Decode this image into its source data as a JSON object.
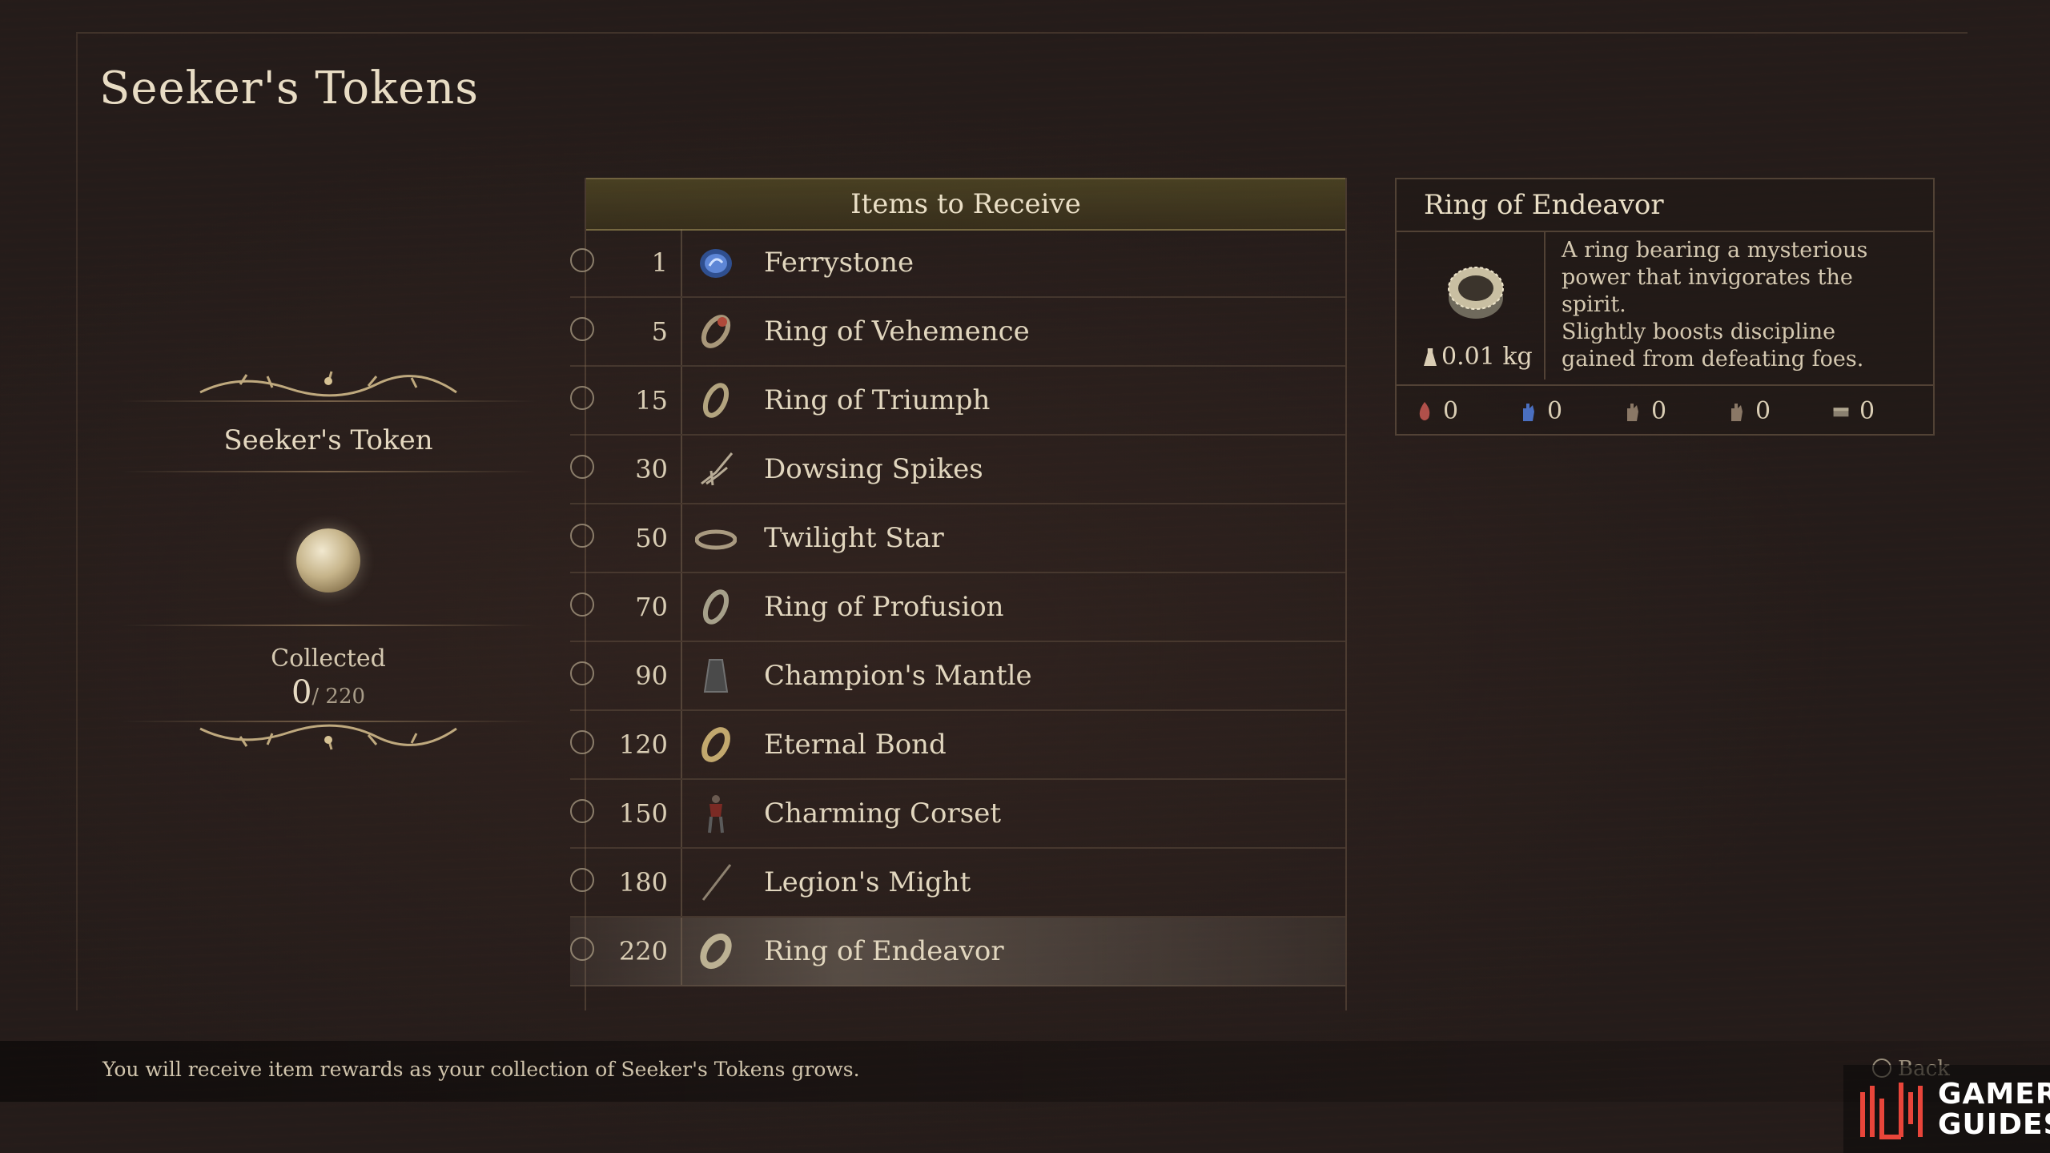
{
  "page": {
    "title": "Seeker's Tokens"
  },
  "token": {
    "name": "Seeker's Token",
    "collected_label": "Collected",
    "collected": "0",
    "total": "/ 220"
  },
  "list": {
    "header": "Items to Receive",
    "items": [
      {
        "count": "1",
        "name": "Ferrystone",
        "icon": "ferrystone-icon"
      },
      {
        "count": "5",
        "name": "Ring of Vehemence",
        "icon": "ring-icon"
      },
      {
        "count": "15",
        "name": "Ring of Triumph",
        "icon": "ring-icon"
      },
      {
        "count": "30",
        "name": "Dowsing Spikes",
        "icon": "spikes-icon"
      },
      {
        "count": "50",
        "name": "Twilight Star",
        "icon": "circlet-icon"
      },
      {
        "count": "70",
        "name": "Ring of Profusion",
        "icon": "ring-icon"
      },
      {
        "count": "90",
        "name": "Champion's Mantle",
        "icon": "mantle-icon"
      },
      {
        "count": "120",
        "name": "Eternal Bond",
        "icon": "ring-icon"
      },
      {
        "count": "150",
        "name": "Charming Corset",
        "icon": "armor-figure-icon"
      },
      {
        "count": "180",
        "name": "Legion's Might",
        "icon": "staff-icon"
      },
      {
        "count": "220",
        "name": "Ring of Endeavor",
        "icon": "ring-icon",
        "selected": true
      }
    ]
  },
  "detail": {
    "title": "Ring of Endeavor",
    "weight": "0.01 kg",
    "description": "A ring bearing a mysterious power that invigorates the spirit.\nSlightly boosts discipline gained from defeating foes.",
    "stats": [
      {
        "icon": "fire-resist-icon",
        "value": "0"
      },
      {
        "icon": "ice-resist-icon",
        "value": "0"
      },
      {
        "icon": "hand-icon",
        "value": "0"
      },
      {
        "icon": "hand-icon",
        "value": "0"
      },
      {
        "icon": "chest-icon",
        "value": "0"
      }
    ]
  },
  "footer": {
    "hint": "You will receive item rewards as your collection of Seeker's Tokens grows.",
    "back": "Back"
  },
  "brand": {
    "line1": "GAMER",
    "line2": "GUIDES"
  }
}
